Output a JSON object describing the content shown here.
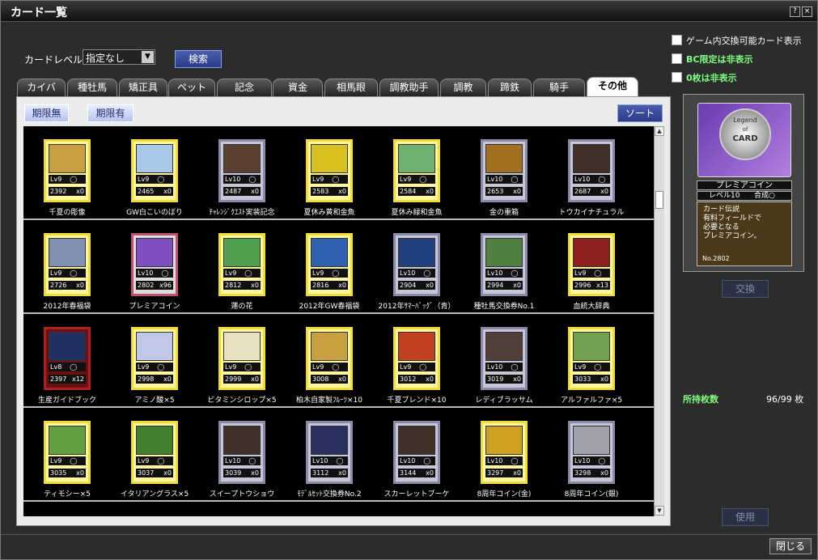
{
  "window": {
    "title": "カード一覧",
    "help": "?",
    "close_x": "×"
  },
  "filter": {
    "level_label": "カードレベル:",
    "level_value": "指定なし",
    "search_label": "検索"
  },
  "tabs": [
    {
      "label": "カイバ",
      "active": false
    },
    {
      "label": "種牡馬",
      "active": false
    },
    {
      "label": "矯正具",
      "active": false
    },
    {
      "label": "ペット",
      "active": false
    },
    {
      "label": "記念",
      "active": false
    },
    {
      "label": "資金",
      "active": false
    },
    {
      "label": "相馬眼",
      "active": false
    },
    {
      "label": "調教助手",
      "active": false
    },
    {
      "label": "調教",
      "active": false
    },
    {
      "label": "蹄鉄",
      "active": false
    },
    {
      "label": "騎手",
      "active": false
    },
    {
      "label": "その他",
      "active": true
    }
  ],
  "subtabs": {
    "unlimited": "期限無",
    "limited": "期限有",
    "sort": "ソート"
  },
  "cards": [
    [
      {
        "name": "千夏の彫像",
        "lv": "Lv9",
        "circle": "◯",
        "id": "2392",
        "count": "x0",
        "frame": "gold",
        "art": "#c8a040"
      },
      {
        "name": "GW白こいのぼり",
        "lv": "Lv9",
        "circle": "◯",
        "id": "2465",
        "count": "x0",
        "frame": "gold",
        "art": "#a8c8e8"
      },
      {
        "name": "ﾁｬﾚﾝｼﾞｸｴｽﾄ実装記念",
        "lv": "Lv10",
        "circle": "◯",
        "id": "2487",
        "count": "x0",
        "frame": "silver",
        "art": "#5a4030"
      },
      {
        "name": "夏休み黄和金魚",
        "lv": "Lv9",
        "circle": "◯",
        "id": "2583",
        "count": "x0",
        "frame": "gold",
        "art": "#d8c020"
      },
      {
        "name": "夏休み緑和金魚",
        "lv": "Lv9",
        "circle": "◯",
        "id": "2584",
        "count": "x0",
        "frame": "gold",
        "art": "#70b070"
      },
      {
        "name": "金の重箱",
        "lv": "Lv10",
        "circle": "◯",
        "id": "2653",
        "count": "x0",
        "frame": "silver",
        "art": "#a07020"
      },
      {
        "name": "トウカイナチュラル",
        "lv": "Lv10",
        "circle": "◯",
        "id": "2687",
        "count": "x0",
        "frame": "silver",
        "art": "#403028"
      }
    ],
    [
      {
        "name": "2012年春福袋",
        "lv": "Lv9",
        "circle": "◯",
        "id": "2726",
        "count": "x0",
        "frame": "gold",
        "art": "#8090b0"
      },
      {
        "name": "プレミアコイン",
        "lv": "Lv10",
        "circle": "◯",
        "id": "2802",
        "count": "x96",
        "frame": "red2",
        "art": "#8050c0"
      },
      {
        "name": "蓮の花",
        "lv": "Lv9",
        "circle": "◯",
        "id": "2812",
        "count": "x0",
        "frame": "gold",
        "art": "#50a050"
      },
      {
        "name": "2012年GW春福袋",
        "lv": "Lv9",
        "circle": "◯",
        "id": "2816",
        "count": "x0",
        "frame": "gold",
        "art": "#3060b0"
      },
      {
        "name": "2012年ｻﾏｰﾊﾞｯｸﾞ（青）",
        "lv": "Lv10",
        "circle": "◯",
        "id": "2904",
        "count": "x0",
        "frame": "silver",
        "art": "#204080"
      },
      {
        "name": "種牡馬交換券No.1",
        "lv": "Lv10",
        "circle": "◯",
        "id": "2994",
        "count": "x0",
        "frame": "silver",
        "art": "#508040"
      },
      {
        "name": "血統大辞典",
        "lv": "Lv9",
        "circle": "◯",
        "id": "2996",
        "count": "x13",
        "frame": "gold",
        "art": "#902020"
      }
    ],
    [
      {
        "name": "生産ガイドブック",
        "lv": "Lv8",
        "circle": "◯",
        "id": "2397",
        "count": "x12",
        "frame": "red",
        "art": "#203060"
      },
      {
        "name": "アミノ酸×5",
        "lv": "Lv9",
        "circle": "◯",
        "id": "2998",
        "count": "x0",
        "frame": "gold",
        "art": "#c0c8e8"
      },
      {
        "name": "ビタミンシロップ×5",
        "lv": "Lv9",
        "circle": "◯",
        "id": "2999",
        "count": "x0",
        "frame": "gold",
        "art": "#e8e0c0"
      },
      {
        "name": "柏木自家製ﾌﾙｰﾂ×10",
        "lv": "Lv9",
        "circle": "◯",
        "id": "3008",
        "count": "x0",
        "frame": "gold",
        "art": "#c8a040"
      },
      {
        "name": "千夏ブレンド×10",
        "lv": "Lv9",
        "circle": "◯",
        "id": "3012",
        "count": "x0",
        "frame": "gold",
        "art": "#c04020"
      },
      {
        "name": "レディブラッサム",
        "lv": "Lv10",
        "circle": "◯",
        "id": "3019",
        "count": "x0",
        "frame": "silver",
        "art": "#504038"
      },
      {
        "name": "アルファルファ×5",
        "lv": "Lv9",
        "circle": "◯",
        "id": "3033",
        "count": "x0",
        "frame": "gold",
        "art": "#70a050"
      }
    ],
    [
      {
        "name": "ティモシー×5",
        "lv": "Lv9",
        "circle": "◯",
        "id": "3035",
        "count": "x0",
        "frame": "gold",
        "art": "#60a040"
      },
      {
        "name": "イタリアングラス×5",
        "lv": "Lv9",
        "circle": "◯",
        "id": "3037",
        "count": "x0",
        "frame": "gold",
        "art": "#408030"
      },
      {
        "name": "スイープトウショウ",
        "lv": "Lv10",
        "circle": "◯",
        "id": "3039",
        "count": "x0",
        "frame": "silver",
        "art": "#403028"
      },
      {
        "name": "ﾓﾃﾞﾙｾｯﾄ交換券No.2",
        "lv": "Lv10",
        "circle": "◯",
        "id": "3112",
        "count": "x0",
        "frame": "silver",
        "art": "#2a3060"
      },
      {
        "name": "スカーレットブーケ",
        "lv": "Lv10",
        "circle": "◯",
        "id": "3144",
        "count": "x0",
        "frame": "silver",
        "art": "#403028"
      },
      {
        "name": "8周年コイン(金)",
        "lv": "Lv10",
        "circle": "◯",
        "id": "3297",
        "count": "x0",
        "frame": "gold",
        "art": "#d0a020"
      },
      {
        "name": "8周年コイン(銀)",
        "lv": "Lv10",
        "circle": "◯",
        "id": "3298",
        "count": "x0",
        "frame": "silver",
        "art": "#a0a0a8"
      }
    ]
  ],
  "options": {
    "exchangeable": "ゲーム内交換可能カード表示",
    "bc_hide": "BC限定は非表示",
    "zero_hide": "0枚は非表示"
  },
  "detail": {
    "coin_top": "Legend",
    "coin_mid": "of",
    "coin_bot": "CARD",
    "name": "プレミアコイン",
    "level": "レベル10",
    "synth": "合成○",
    "desc1": "カード伝説",
    "desc2": "有料フィールドで",
    "desc3": "必要となる",
    "desc4": "プレミアコイン。",
    "no": "No.2802",
    "exchange_label": "交換"
  },
  "owned": {
    "label": "所持枚数",
    "value": "96/99 枚"
  },
  "use_label": "使用",
  "close_label": "閉じる",
  "accent_colors": {
    "option_green": "#7fff7f",
    "tab_active": "#ffffff",
    "button_blue": "#2a3a88"
  }
}
